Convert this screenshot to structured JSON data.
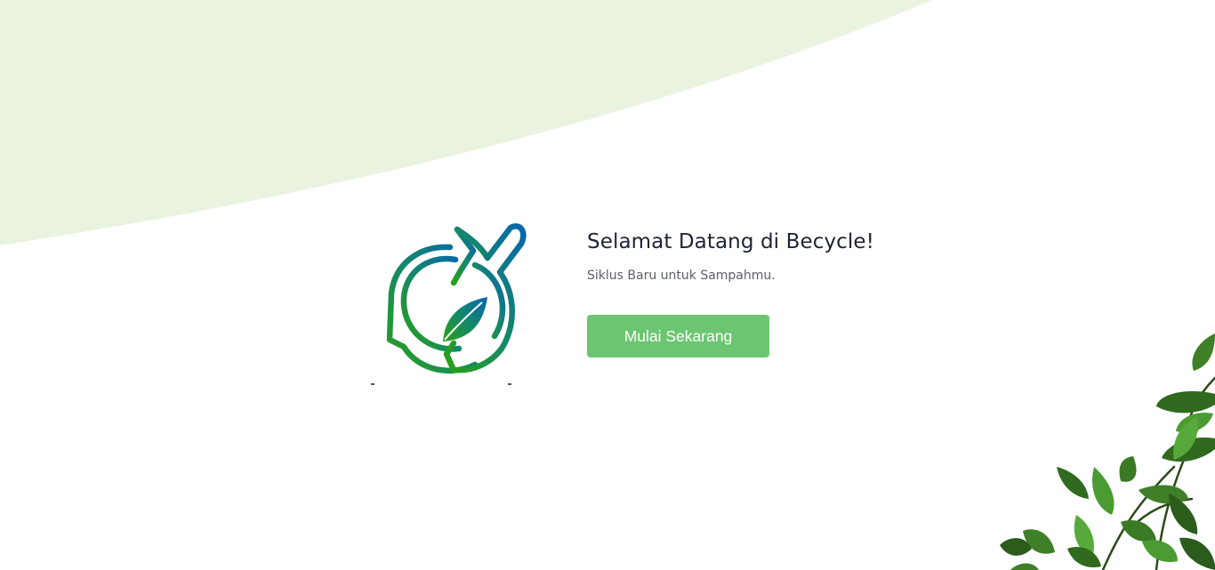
{
  "hero": {
    "title": "Selamat Datang di Becycle!",
    "subtitle": "Siklus Baru untuk Sampahmu.",
    "cta_label": "Mulai Sekarang"
  },
  "colors": {
    "background_arc": "#eaf3df",
    "cta": "#6cc570",
    "logo_gradient_start": "#1f9a2a",
    "logo_gradient_end": "#0a6aa8",
    "leaf_dark": "#2e6b1f",
    "leaf_light": "#4f9a34"
  },
  "icons": {
    "logo": "becycle-recycle-leaf-logo",
    "decoration": "plant-leaves"
  }
}
